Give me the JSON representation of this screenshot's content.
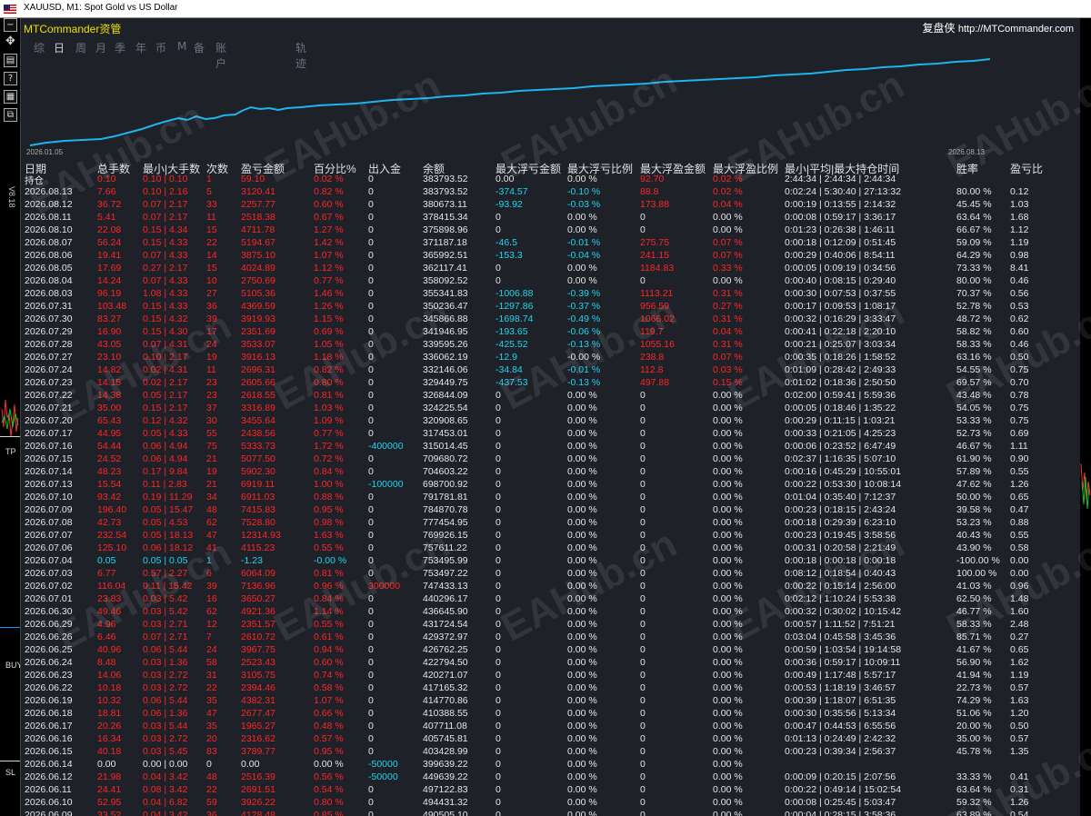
{
  "window": {
    "title": "XAUUSD, M1:  Spot Gold vs US Dollar"
  },
  "side_labels": {
    "vertical": "V8.18",
    "tp": "TP",
    "buy": "BUY",
    "sl": "SL"
  },
  "panel": {
    "brand": "MTCommander资管",
    "site_prefix": "复盘侠",
    "site_url": "http://MTCommander.com",
    "tabs": [
      "综",
      "日",
      "周",
      "月",
      "季",
      "年",
      "币",
      "M",
      "备",
      "账户",
      "轨迹"
    ],
    "active_tab": "日"
  },
  "equity_chart": {
    "start_label": "2026.01.05",
    "end_label": "2026.08.13",
    "line_color": "#1eb4f0"
  },
  "watermark": "EAHub.cn",
  "columns": [
    "日期",
    "总手数",
    "最小|大手数",
    "次数",
    "盈亏金额",
    "百分比%",
    "出入金",
    "余额",
    "最大浮亏金额",
    "最大浮亏比例",
    "最大浮盈金额",
    "最大浮盈比例",
    "最小|平均|最大持仓时间",
    "胜率",
    "盈亏比"
  ],
  "rows": [
    [
      "持仓",
      "0.10",
      "0.10 | 0.10",
      "1",
      "59.10",
      "0.02 %",
      "0",
      "383793.52",
      "0.00",
      "0.00 %",
      "92.70",
      "0.02 %",
      "2:44:34 | 2:44:34 | 2:44:34",
      "",
      ""
    ],
    [
      "2026.08.13",
      "7.66",
      "0.10 | 2.16",
      "5",
      "3120.41",
      "0.82 %",
      "0",
      "383793.52",
      "-374.57",
      "-0.10 %",
      "88.8",
      "0.02 %",
      "0:02:24 | 5:30:40 | 27:13:32",
      "80.00 %",
      "0.12"
    ],
    [
      "2026.08.12",
      "36.72",
      "0.07 | 2.17",
      "33",
      "2257.77",
      "0.60 %",
      "0",
      "380673.11",
      "-93.92",
      "-0.03 %",
      "173.88",
      "0.04 %",
      "0:00:19 | 0:13:55 | 2:14:32",
      "45.45 %",
      "1.03"
    ],
    [
      "2026.08.11",
      "5.41",
      "0.07 | 2.17",
      "11",
      "2518.38",
      "0.67 %",
      "0",
      "378415.34",
      "0",
      "0.00 %",
      "0",
      "0.00 %",
      "0:00:08 | 0:59:17 | 3:36:17",
      "63.64 %",
      "1.68"
    ],
    [
      "2026.08.10",
      "22.08",
      "0.15 | 4.34",
      "15",
      "4711.78",
      "1.27 %",
      "0",
      "375898.96",
      "0",
      "0.00 %",
      "0",
      "0.00 %",
      "0:01:23 | 0:26:38 | 1:46:11",
      "66.67 %",
      "1.12"
    ],
    [
      "2026.08.07",
      "56.24",
      "0.15 | 4.33",
      "22",
      "5194.67",
      "1.42 %",
      "0",
      "371187.18",
      "-46.5",
      "-0.01 %",
      "275.75",
      "0.07 %",
      "0:00:18 | 0:12:09 | 0:51:45",
      "59.09 %",
      "1.19"
    ],
    [
      "2026.08.06",
      "19.41",
      "0.07 | 4.33",
      "14",
      "3875.10",
      "1.07 %",
      "0",
      "365992.51",
      "-153.3",
      "-0.04 %",
      "241.15",
      "0.07 %",
      "0:00:29 | 0:40:06 | 8:54:11",
      "64.29 %",
      "0.98"
    ],
    [
      "2026.08.05",
      "17.69",
      "0.27 | 2.17",
      "15",
      "4024.89",
      "1.12 %",
      "0",
      "362117.41",
      "0",
      "0.00 %",
      "1184.83",
      "0.33 %",
      "0:00:05 | 0:09:19 | 0:34:56",
      "73.33 %",
      "8.41"
    ],
    [
      "2026.08.04",
      "14.24",
      "0.07 | 4.33",
      "10",
      "2750.69",
      "0.77 %",
      "0",
      "358092.52",
      "0",
      "0.00 %",
      "0",
      "0.00 %",
      "0:00:40 | 0:08:15 | 0:29:40",
      "80.00 %",
      "0.46"
    ],
    [
      "2026.08.03",
      "96.19",
      "1.08 | 4.33",
      "27",
      "5105.36",
      "1.46 %",
      "0",
      "355341.83",
      "-1006.88",
      "-0.39 %",
      "1113.21",
      "0.31 %",
      "0:00:30 | 0:07:53 | 0:37:55",
      "70.37 %",
      "0.56"
    ],
    [
      "2026.07.31",
      "103.48",
      "0.15 | 4.33",
      "36",
      "4369.59",
      "1.26 %",
      "0",
      "350236.47",
      "-1297.86",
      "-0.37 %",
      "956.59",
      "0.27 %",
      "0:00:17 | 0:09:53 | 1:08:17",
      "52.78 %",
      "0.53"
    ],
    [
      "2026.07.30",
      "83.27",
      "0.15 | 4.32",
      "39",
      "3919.93",
      "1.15 %",
      "0",
      "345866.88",
      "-1698.74",
      "-0.49 %",
      "1066.02",
      "0.31 %",
      "0:00:32 | 0:16:29 | 3:33:47",
      "48.72 %",
      "0.62"
    ],
    [
      "2026.07.29",
      "16.90",
      "0.15 | 4.30",
      "17",
      "2351.69",
      "0.69 %",
      "0",
      "341946.95",
      "-193.65",
      "-0.06 %",
      "119.7",
      "0.04 %",
      "0:00:41 | 0:22:18 | 2:20:10",
      "58.82 %",
      "0.60"
    ],
    [
      "2026.07.28",
      "43.05",
      "0.07 | 4.31",
      "24",
      "3533.07",
      "1.05 %",
      "0",
      "339595.26",
      "-425.52",
      "-0.13 %",
      "1055.16",
      "0.31 %",
      "0:00:21 | 0:25:07 | 3:03:34",
      "58.33 %",
      "0.46"
    ],
    [
      "2026.07.27",
      "23.10",
      "0.10 | 2.17",
      "19",
      "3916.13",
      "1.18 %",
      "0",
      "336062.19",
      "-12.9",
      "-0.00 %",
      "238.8",
      "0.07 %",
      "0:00:35 | 0:18:26 | 1:58:52",
      "63.16 %",
      "0.50"
    ],
    [
      "2026.07.24",
      "14.82",
      "0.02 | 4.31",
      "11",
      "2696.31",
      "0.82 %",
      "0",
      "332146.06",
      "-34.84",
      "-0.01 %",
      "112.8",
      "0.03 %",
      "0:01:09 | 0:28:42 | 2:49:33",
      "54.55 %",
      "0.75"
    ],
    [
      "2026.07.23",
      "14.15",
      "0.02 | 2.17",
      "23",
      "2605.66",
      "0.80 %",
      "0",
      "329449.75",
      "-437.53",
      "-0.13 %",
      "497.88",
      "0.15 %",
      "0:01:02 | 0:18:36 | 2:50:50",
      "69.57 %",
      "0.70"
    ],
    [
      "2026.07.22",
      "14.38",
      "0.05 | 2.17",
      "23",
      "2618.55",
      "0.81 %",
      "0",
      "326844.09",
      "0",
      "0.00 %",
      "0",
      "0.00 %",
      "0:02:00 | 0:59:41 | 5:59:36",
      "43.48 %",
      "0.78"
    ],
    [
      "2026.07.21",
      "35.00",
      "0.15 | 2.17",
      "37",
      "3316.89",
      "1.03 %",
      "0",
      "324225.54",
      "0",
      "0.00 %",
      "0",
      "0.00 %",
      "0:00:05 | 0:18:46 | 1:35:22",
      "54.05 %",
      "0.75"
    ],
    [
      "2026.07.20",
      "65.43",
      "0.12 | 4.32",
      "30",
      "3455.64",
      "1.09 %",
      "0",
      "320908.65",
      "0",
      "0.00 %",
      "0",
      "0.00 %",
      "0:00:29 | 0:11:15 | 1:03:21",
      "53.33 %",
      "0.75"
    ],
    [
      "2026.07.17",
      "44.95",
      "0.05 | 4.33",
      "55",
      "2438.56",
      "0.77 %",
      "0",
      "317453.01",
      "0",
      "0.00 %",
      "0",
      "0.00 %",
      "0:00:33 | 0:21:05 | 4:25:23",
      "52.73 %",
      "0.69"
    ],
    [
      "2026.07.16",
      "54.44",
      "0.06 | 4.94",
      "75",
      "5333.73",
      "1.72 %",
      "-400000",
      "315014.45",
      "0",
      "0.00 %",
      "0",
      "0.00 %",
      "0:00:06 | 0:23:52 | 6:47:49",
      "46.67 %",
      "1.11"
    ],
    [
      "2026.07.15",
      "24.52",
      "0.06 | 4.94",
      "21",
      "5077.50",
      "0.72 %",
      "0",
      "709680.72",
      "0",
      "0.00 %",
      "0",
      "0.00 %",
      "0:02:37 | 1:16:35 | 5:07:10",
      "61.90 %",
      "0.90"
    ],
    [
      "2026.07.14",
      "48.23",
      "0.17 | 9.84",
      "19",
      "5902.30",
      "0.84 %",
      "0",
      "704603.22",
      "0",
      "0.00 %",
      "0",
      "0.00 %",
      "0:00:16 | 0:45:29 | 10:55:01",
      "57.89 %",
      "0.55"
    ],
    [
      "2026.07.13",
      "15.54",
      "0.11 | 2.83",
      "21",
      "6919.11",
      "1.00 %",
      "-100000",
      "698700.92",
      "0",
      "0.00 %",
      "0",
      "0.00 %",
      "0:00:22 | 0:53:30 | 10:08:14",
      "47.62 %",
      "1.26"
    ],
    [
      "2026.07.10",
      "93.42",
      "0.19 | 11.29",
      "34",
      "6911.03",
      "0.88 %",
      "0",
      "791781.81",
      "0",
      "0.00 %",
      "0",
      "0.00 %",
      "0:01:04 | 0:35:40 | 7:12:37",
      "50.00 %",
      "0.65"
    ],
    [
      "2026.07.09",
      "196.40",
      "0.05 | 15.47",
      "48",
      "7415.83",
      "0.95 %",
      "0",
      "784870.78",
      "0",
      "0.00 %",
      "0",
      "0.00 %",
      "0:00:23 | 0:18:15 | 2:43:24",
      "39.58 %",
      "0.47"
    ],
    [
      "2026.07.08",
      "42.73",
      "0.05 | 4.53",
      "62",
      "7528.80",
      "0.98 %",
      "0",
      "777454.95",
      "0",
      "0.00 %",
      "0",
      "0.00 %",
      "0:00:18 | 0:29:39 | 6:23:10",
      "53.23 %",
      "0.88"
    ],
    [
      "2026.07.07",
      "232.54",
      "0.05 | 18.13",
      "47",
      "12314.93",
      "1.63 %",
      "0",
      "769926.15",
      "0",
      "0.00 %",
      "0",
      "0.00 %",
      "0:00:23 | 0:19:45 | 3:58:56",
      "40.43 %",
      "0.55"
    ],
    [
      "2026.07.06",
      "125.10",
      "0.06 | 18.12",
      "41",
      "4115.23",
      "0.55 %",
      "0",
      "757611.22",
      "0",
      "0.00 %",
      "0",
      "0.00 %",
      "0:00:31 | 0:20:58 | 2:21:49",
      "43.90 %",
      "0.58"
    ],
    [
      "2026.07.04",
      "0.05",
      "0.05 | 0.05",
      "1",
      "-1.23",
      "-0.00 %",
      "0",
      "753495.99",
      "0",
      "0.00 %",
      "0",
      "0.00 %",
      "0:00:18 | 0:00:18 | 0:00:18",
      "-100.00 %",
      "0.00"
    ],
    [
      "2026.07.03",
      "6.77",
      "0.57 | 2.27",
      "6",
      "6064.09",
      "0.81 %",
      "0",
      "753497.22",
      "0",
      "0.00 %",
      "0",
      "0.00 %",
      "0:08:12 | 0:18:54 | 0:40:43",
      "100.00 %",
      "0.00"
    ],
    [
      "2026.07.02",
      "116.04",
      "0.11 | 15.42",
      "39",
      "7136.96",
      "0.96 %",
      "300000",
      "747433.13",
      "0",
      "0.00 %",
      "0",
      "0.00 %",
      "0:00:22 | 0:15:14 | 2:56:00",
      "41.03 %",
      "0.96"
    ],
    [
      "2026.07.01",
      "23.83",
      "0.03 | 5.42",
      "16",
      "3650.27",
      "0.84 %",
      "0",
      "440296.17",
      "0",
      "0.00 %",
      "0",
      "0.00 %",
      "0:02:12 | 1:10:24 | 5:53:38",
      "62.50 %",
      "1.48"
    ],
    [
      "2026.06.30",
      "49.46",
      "0.03 | 5.42",
      "62",
      "4921.36",
      "1.14 %",
      "0",
      "436645.90",
      "0",
      "0.00 %",
      "0",
      "0.00 %",
      "0:00:32 | 0:30:02 | 10:15:42",
      "46.77 %",
      "1.60"
    ],
    [
      "2026.06.29",
      "4.96",
      "0.03 | 2.71",
      "12",
      "2351.57",
      "0.55 %",
      "0",
      "431724.54",
      "0",
      "0.00 %",
      "0",
      "0.00 %",
      "0:00:57 | 1:11:52 | 7:51:21",
      "58.33 %",
      "2.48"
    ],
    [
      "2026.06.26",
      "6.46",
      "0.07 | 2.71",
      "7",
      "2610.72",
      "0.61 %",
      "0",
      "429372.97",
      "0",
      "0.00 %",
      "0",
      "0.00 %",
      "0:03:04 | 0:45:58 | 3:45:36",
      "85.71 %",
      "0.27"
    ],
    [
      "2026.06.25",
      "40.96",
      "0.06 | 5.44",
      "24",
      "3967.75",
      "0.94 %",
      "0",
      "426762.25",
      "0",
      "0.00 %",
      "0",
      "0.00 %",
      "0:00:59 | 1:03:54 | 19:14:58",
      "41.67 %",
      "0.65"
    ],
    [
      "2026.06.24",
      "8.48",
      "0.03 | 1.36",
      "58",
      "2523.43",
      "0.60 %",
      "0",
      "422794.50",
      "0",
      "0.00 %",
      "0",
      "0.00 %",
      "0:00:36 | 0:59:17 | 10:09:11",
      "56.90 %",
      "1.62"
    ],
    [
      "2026.06.23",
      "14.06",
      "0.03 | 2.72",
      "31",
      "3105.75",
      "0.74 %",
      "0",
      "420271.07",
      "0",
      "0.00 %",
      "0",
      "0.00 %",
      "0:00:49 | 1:17:48 | 5:57:17",
      "41.94 %",
      "1.19"
    ],
    [
      "2026.06.22",
      "10.18",
      "0.03 | 2.72",
      "22",
      "2394.46",
      "0.58 %",
      "0",
      "417165.32",
      "0",
      "0.00 %",
      "0",
      "0.00 %",
      "0:00:53 | 1:18:19 | 3:46:57",
      "22.73 %",
      "0.57"
    ],
    [
      "2026.06.19",
      "10.32",
      "0.06 | 5.44",
      "35",
      "4382.31",
      "1.07 %",
      "0",
      "414770.86",
      "0",
      "0.00 %",
      "0",
      "0.00 %",
      "0:00:39 | 1:18:07 | 6:51:35",
      "74.29 %",
      "1.63"
    ],
    [
      "2026.06.18",
      "18.81",
      "0.06 | 1.36",
      "47",
      "2677.47",
      "0.66 %",
      "0",
      "410388.55",
      "0",
      "0.00 %",
      "0",
      "0.00 %",
      "0:00:30 | 0:35:56 | 5:13:34",
      "51.06 %",
      "1.20"
    ],
    [
      "2026.06.17",
      "20.26",
      "0.03 | 5.44",
      "35",
      "1965.27",
      "0.48 %",
      "0",
      "407711.08",
      "0",
      "0.00 %",
      "0",
      "0.00 %",
      "0:00:47 | 0:44:53 | 6:55:56",
      "20.00 %",
      "0.50"
    ],
    [
      "2026.06.16",
      "16.34",
      "0.03 | 2.72",
      "20",
      "2316.62",
      "0.57 %",
      "0",
      "405745.81",
      "0",
      "0.00 %",
      "0",
      "0.00 %",
      "0:01:13 | 0:24:49 | 2:42:32",
      "35.00 %",
      "0.57"
    ],
    [
      "2026.06.15",
      "40.18",
      "0.03 | 5.45",
      "83",
      "3789.77",
      "0.95 %",
      "0",
      "403428.99",
      "0",
      "0.00 %",
      "0",
      "0.00 %",
      "0:00:23 | 0:39:34 | 2:56:37",
      "45.78 %",
      "1.35"
    ],
    [
      "2026.06.14",
      "0.00",
      "0.00 | 0.00",
      "0",
      "0.00",
      "0.00 %",
      "-50000",
      "399639.22",
      "0",
      "0.00 %",
      "0",
      "0.00 %",
      "",
      "",
      ""
    ],
    [
      "2026.06.12",
      "21.98",
      "0.04 | 3.42",
      "48",
      "2516.39",
      "0.56 %",
      "-50000",
      "449639.22",
      "0",
      "0.00 %",
      "0",
      "0.00 %",
      "0:00:09 | 0:20:15 | 2:07:56",
      "33.33 %",
      "0.41"
    ],
    [
      "2026.06.11",
      "24.41",
      "0.08 | 3.42",
      "22",
      "2691.51",
      "0.54 %",
      "0",
      "497122.83",
      "0",
      "0.00 %",
      "0",
      "0.00 %",
      "0:00:22 | 0:49:14 | 15:02:54",
      "63.64 %",
      "0.31"
    ],
    [
      "2026.06.10",
      "52.95",
      "0.04 | 6.82",
      "59",
      "3926.22",
      "0.80 %",
      "0",
      "494431.32",
      "0",
      "0.00 %",
      "0",
      "0.00 %",
      "0:00:08 | 0:25:45 | 5:03:47",
      "59.32 %",
      "1.26"
    ],
    [
      "2026.06.09",
      "33.52",
      "0.04 | 3.42",
      "36",
      "4128.48",
      "0.85 %",
      "0",
      "490505.10",
      "0",
      "0.00 %",
      "0",
      "0.00 %",
      "0:00:04 | 0:28:15 | 3:58:36",
      "63.89 %",
      "0.54"
    ]
  ]
}
